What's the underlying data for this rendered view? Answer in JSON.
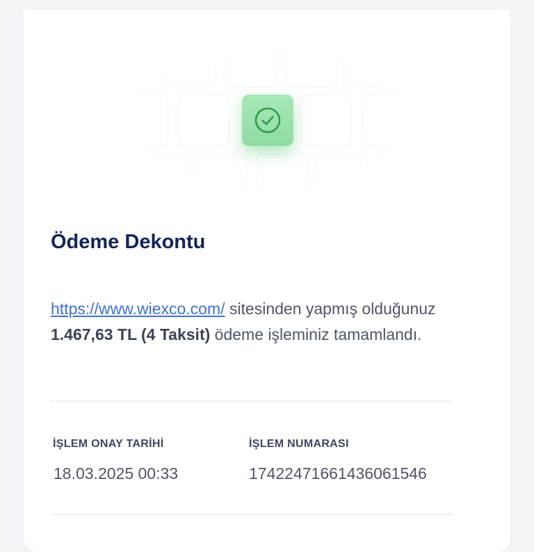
{
  "receipt": {
    "title": "Ödeme Dekontu",
    "description": {
      "link_text": "https://www.wiexco.com/",
      "text_after_link": " sitesinden yapmış olduğunuz ",
      "amount": "1.467,63 TL (4 Taksit)",
      "text_after_amount": " ödeme işleminiz tamamlandı."
    },
    "fields": [
      {
        "label": "İŞLEM ONAY TARİHİ",
        "value": "18.03.2025 00:33"
      },
      {
        "label": "İŞLEM NUMARASI",
        "value": "17422471661436061546"
      }
    ]
  },
  "icons": {
    "success": "check-circle-icon"
  },
  "colors": {
    "title": "#13245a",
    "link": "#3d6fd8",
    "success_tile": "#9be3ad",
    "success_icon": "#2f9a4c",
    "background": "#f3f4f7"
  }
}
